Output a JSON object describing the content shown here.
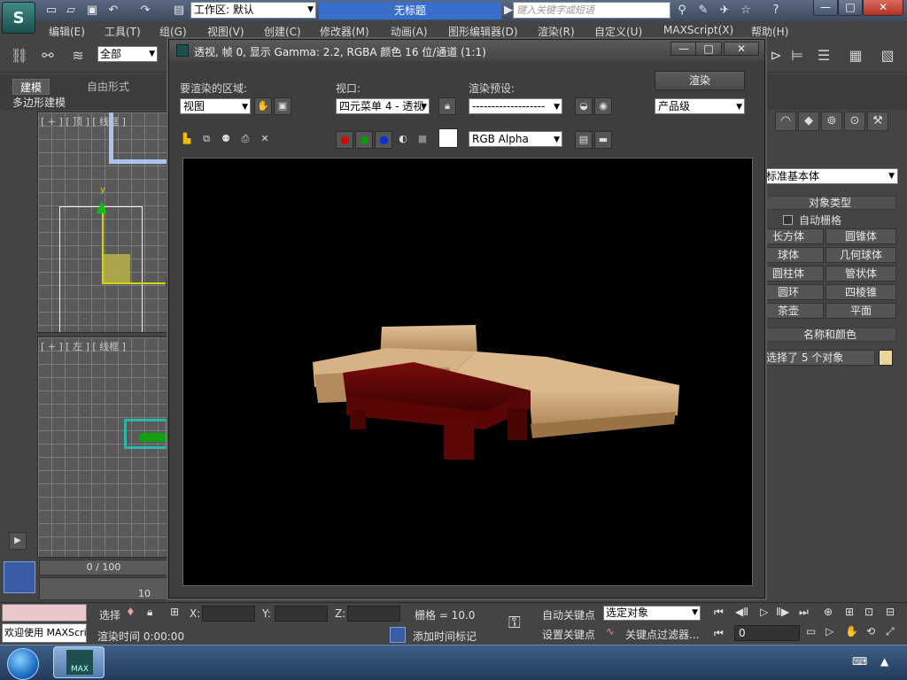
{
  "titlebar": {
    "workspace_label": "工作区: 默认",
    "doc_title": "无标题",
    "search_placeholder": "键入关键字或短语",
    "minimize": "—",
    "maximize": "□",
    "close": "✕"
  },
  "menu": [
    "编辑(E)",
    "工具(T)",
    "组(G)",
    "视图(V)",
    "创建(C)",
    "修改器(M)",
    "动画(A)",
    "图形编辑器(D)",
    "渲染(R)",
    "自定义(U)",
    "MAXScript(X)",
    "帮助(H)"
  ],
  "toolbar": {
    "selection_filter": "全部"
  },
  "ribbon": {
    "tabs": [
      "建模",
      "自由形式"
    ],
    "sub_label": "多边形建模"
  },
  "viewports": {
    "top_label": "[ + ] [ 顶 ] [ 线框 ]",
    "left_label": "[ + ] [ 左 ] [ 线框 ]",
    "axis_y": "y"
  },
  "render_window": {
    "title": "透视, 帧 0, 显示 Gamma: 2.2, RGBA 颜色 16 位/通道 (1:1)",
    "area_label": "要渲染的区域:",
    "area_value": "视图",
    "viewport_label": "视口:",
    "viewport_value": "四元菜单 4 - 透视",
    "preset_label": "渲染预设:",
    "preset_value": "-------------------",
    "render_button": "渲染",
    "quality_value": "产品级",
    "channel_value": "RGB Alpha",
    "channel_colors": {
      "red": "#e00000",
      "green": "#00a000",
      "blue": "#0030e0"
    }
  },
  "command_panel": {
    "category_value": "标准基本体",
    "object_type_header": "对象类型",
    "autogrid_label": "自动栅格",
    "object_buttons": [
      "长方体",
      "圆锥体",
      "球体",
      "几何球体",
      "圆柱体",
      "管状体",
      "圆环",
      "四棱锥",
      "茶壶",
      "平面"
    ],
    "name_color_header": "名称和颜色",
    "name_value": "选择了 5 个对象",
    "swatch_color": "#e7d59a"
  },
  "timeline": {
    "frame_counter": "0 / 100",
    "track_tick": "10"
  },
  "status": {
    "script_listener": "欢迎使用 MAXScri",
    "select_label": "选择",
    "x_label": "X:",
    "y_label": "Y:",
    "z_label": "Z:",
    "grid_text": "栅格 = 10.0",
    "auto_key": "自动关键点",
    "key_mode_value": "选定对象",
    "set_key": "设置关键点",
    "key_filters": "关键点过滤器...",
    "render_time": "渲染时间  0:00:00",
    "add_time_tag": "添加时间标记",
    "current_frame": "0"
  },
  "taskbar": {
    "app_label": "MAX"
  }
}
